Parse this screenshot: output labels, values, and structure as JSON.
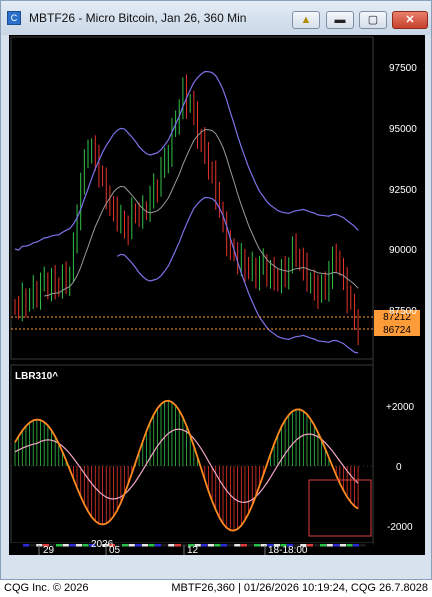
{
  "window": {
    "title": "MBTF26 - Micro Bitcoin, Jan 26, 360 Min",
    "app_icon": "cqg-app-icon",
    "buttons": [
      "warning-icon",
      "minimize-icon",
      "maximize-icon",
      "close-icon"
    ]
  },
  "price_axis": {
    "ticks": [
      "97500",
      "95000",
      "92500",
      "90000",
      "87500"
    ],
    "marker_high": "87212",
    "marker_low": "86724",
    "marker_color": "#ff9c3a"
  },
  "indicator": {
    "label": "LBR310^",
    "ticks": [
      "+2000",
      "0",
      "-2000"
    ]
  },
  "time_axis": {
    "year_label": "2026",
    "labels": [
      "29",
      "05",
      "12",
      "18-18:00"
    ]
  },
  "status_bar": {
    "left": "CQG Inc. © 2026",
    "right": "MBTF26,360 | 01/26/2026 10:19:24, CQG 26.7.8028"
  },
  "colors": {
    "up_bar": "#33c24a",
    "down_bar": "#e8332b",
    "band": "#7b73e8",
    "middle_line": "#9a9a9a",
    "oscillator_fast": "#ff8a1f",
    "oscillator_slow": "#f2a7c8",
    "selection_box": "#e03c3c"
  }
}
